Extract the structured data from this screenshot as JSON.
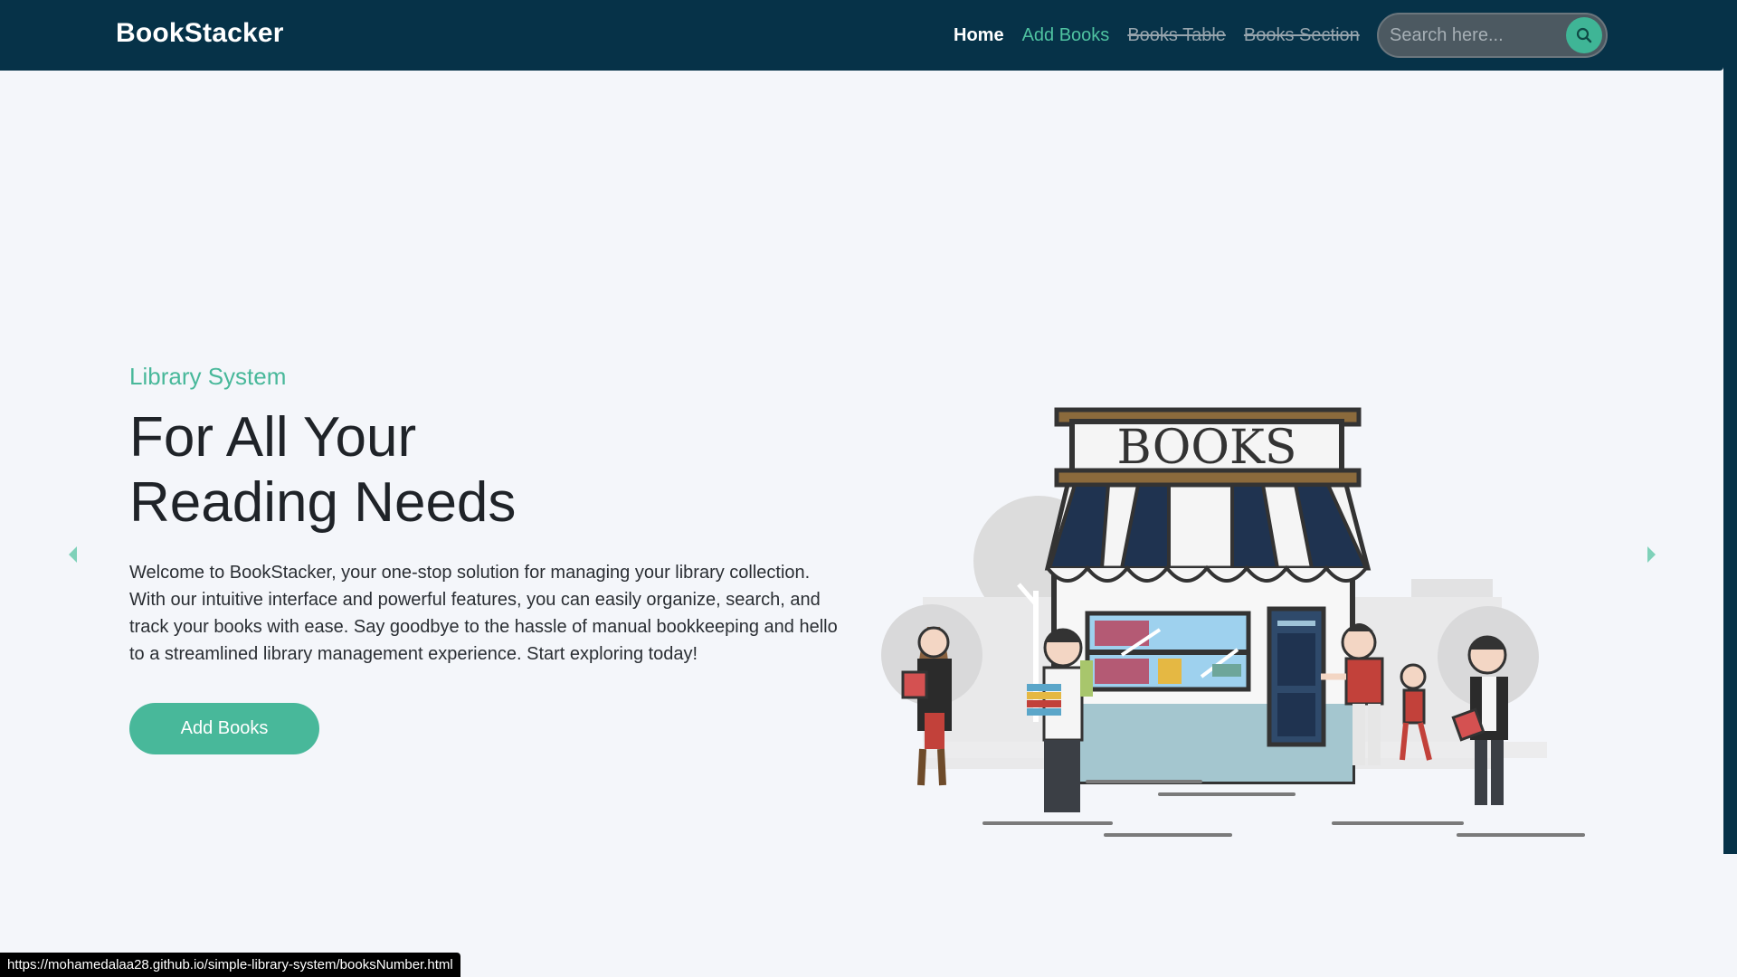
{
  "nav": {
    "brand": "BookStacker",
    "links": [
      "Home",
      "Add Books",
      "Books Table",
      "Books Section"
    ],
    "search_placeholder": "Search here..."
  },
  "hero": {
    "eyebrow": "Library System",
    "headline": [
      "For All Your",
      "Reading Needs"
    ],
    "description": "Welcome to BookStacker, your one-stop solution for managing your library collection. With our intuitive interface and powerful features, you can easily organize, search, and track your books with ease. Say goodbye to the hassle of manual bookkeeping and hello to a streamlined library management experience. Start exploring today!",
    "cta_label": "Add Books"
  },
  "illustration": {
    "shop_sign": "BOOKS"
  },
  "status_bar": {
    "url": "https://mohamedalaa28.github.io/simple-library-system/booksNumber.html"
  },
  "colors": {
    "navbar": "#063248",
    "accent": "#48b89a",
    "background": "#f4f6fa"
  },
  "icons": [
    "search-icon",
    "chevron-left-icon",
    "chevron-right-icon"
  ]
}
